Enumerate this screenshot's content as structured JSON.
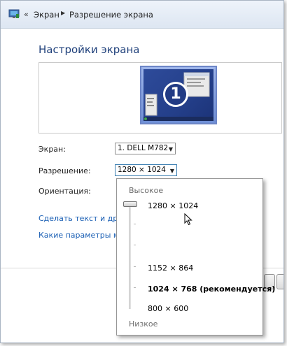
{
  "breadcrumb": {
    "back_glyph": "«",
    "items": [
      "Экран",
      "Разрешение экрана"
    ]
  },
  "page_title": "Настройки экрана",
  "preview": {
    "monitor_number": "1"
  },
  "display_row": {
    "label": "Экран:",
    "value": "1. DELL M782"
  },
  "resolution_row": {
    "label": "Разрешение:",
    "value": "1280 × 1024"
  },
  "orientation_row": {
    "label": "Ориентация:"
  },
  "links": {
    "text_size": "Сделать текст и другие",
    "which_settings": "Какие параметры мон"
  },
  "resolution_dropdown": {
    "high_label": "Высокое",
    "low_label": "Низкое",
    "options": {
      "current": "1280 × 1024",
      "mid": "1152 × 864",
      "recommended": "1024 × 768 (рекомендуется)",
      "lowest": "800 × 600"
    },
    "slider_position_fraction": 0.0
  },
  "colors": {
    "title": "#1e3f7a",
    "link": "#1a5fb4",
    "monitor_border": "#6d86c7",
    "monitor_fill": "#243f8a"
  }
}
